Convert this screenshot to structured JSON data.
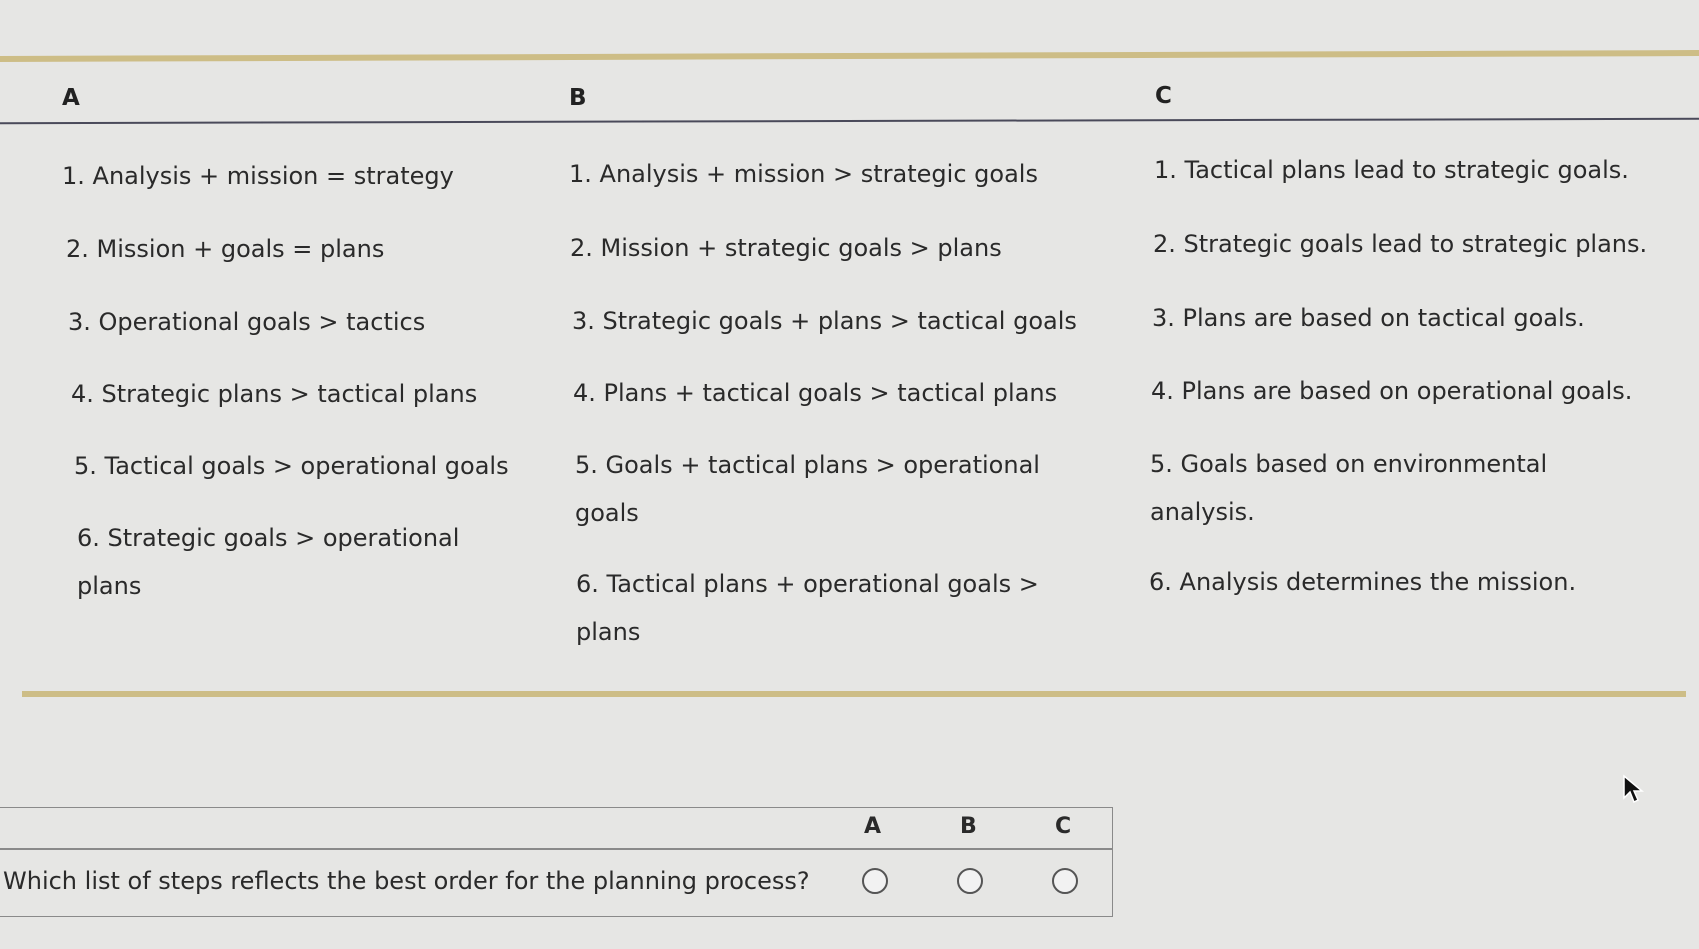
{
  "columns": [
    {
      "label": "A",
      "items": [
        "1. Analysis + mission = strategy",
        "2. Mission + goals = plans",
        "3. Operational goals > tactics",
        "4. Strategic plans > tactical plans",
        "5. Tactical goals > operational goals",
        "6. Strategic goals > operational plans"
      ]
    },
    {
      "label": "B",
      "items": [
        "1. Analysis + mission > strategic goals",
        "2. Mission + strategic goals > plans",
        "3. Strategic goals + plans > tactical goals",
        "4. Plans + tactical goals > tactical plans",
        "5. Goals + tactical plans > operational goals",
        "6. Tactical plans + operational goals > plans"
      ]
    },
    {
      "label": "C",
      "items": [
        "1. Tactical plans lead to strategic goals.",
        "2. Strategic goals lead to strategic plans.",
        "3. Plans are based on tactical goals.",
        "4. Plans are based on operational goals.",
        "5. Goals based on environmental analysis.",
        "6. Analysis determines the mission."
      ]
    }
  ],
  "question": {
    "text": "Which list of steps reflects the best order for the planning process?",
    "options": [
      "A",
      "B",
      "C"
    ],
    "selected": null
  },
  "colors": {
    "accent_rule": "#cdbd86",
    "background": "#e6e6e4"
  }
}
